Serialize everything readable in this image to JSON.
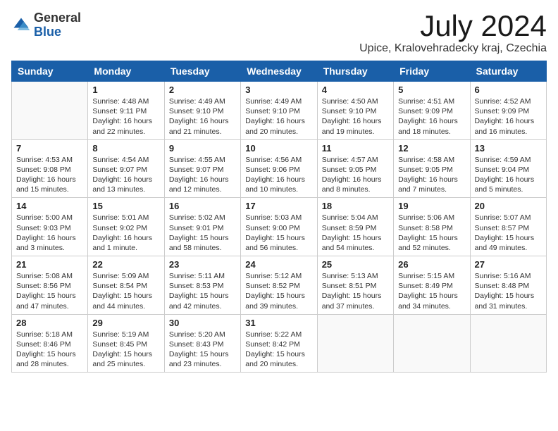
{
  "logo": {
    "general": "General",
    "blue": "Blue"
  },
  "title": "July 2024",
  "location": "Upice, Kralovehradecky kraj, Czechia",
  "days": [
    "Sunday",
    "Monday",
    "Tuesday",
    "Wednesday",
    "Thursday",
    "Friday",
    "Saturday"
  ],
  "weeks": [
    [
      {
        "day": null,
        "content": null
      },
      {
        "day": "1",
        "content": "Sunrise: 4:48 AM\nSunset: 9:11 PM\nDaylight: 16 hours\nand 22 minutes."
      },
      {
        "day": "2",
        "content": "Sunrise: 4:49 AM\nSunset: 9:10 PM\nDaylight: 16 hours\nand 21 minutes."
      },
      {
        "day": "3",
        "content": "Sunrise: 4:49 AM\nSunset: 9:10 PM\nDaylight: 16 hours\nand 20 minutes."
      },
      {
        "day": "4",
        "content": "Sunrise: 4:50 AM\nSunset: 9:10 PM\nDaylight: 16 hours\nand 19 minutes."
      },
      {
        "day": "5",
        "content": "Sunrise: 4:51 AM\nSunset: 9:09 PM\nDaylight: 16 hours\nand 18 minutes."
      },
      {
        "day": "6",
        "content": "Sunrise: 4:52 AM\nSunset: 9:09 PM\nDaylight: 16 hours\nand 16 minutes."
      }
    ],
    [
      {
        "day": "7",
        "content": "Sunrise: 4:53 AM\nSunset: 9:08 PM\nDaylight: 16 hours\nand 15 minutes."
      },
      {
        "day": "8",
        "content": "Sunrise: 4:54 AM\nSunset: 9:07 PM\nDaylight: 16 hours\nand 13 minutes."
      },
      {
        "day": "9",
        "content": "Sunrise: 4:55 AM\nSunset: 9:07 PM\nDaylight: 16 hours\nand 12 minutes."
      },
      {
        "day": "10",
        "content": "Sunrise: 4:56 AM\nSunset: 9:06 PM\nDaylight: 16 hours\nand 10 minutes."
      },
      {
        "day": "11",
        "content": "Sunrise: 4:57 AM\nSunset: 9:05 PM\nDaylight: 16 hours\nand 8 minutes."
      },
      {
        "day": "12",
        "content": "Sunrise: 4:58 AM\nSunset: 9:05 PM\nDaylight: 16 hours\nand 7 minutes."
      },
      {
        "day": "13",
        "content": "Sunrise: 4:59 AM\nSunset: 9:04 PM\nDaylight: 16 hours\nand 5 minutes."
      }
    ],
    [
      {
        "day": "14",
        "content": "Sunrise: 5:00 AM\nSunset: 9:03 PM\nDaylight: 16 hours\nand 3 minutes."
      },
      {
        "day": "15",
        "content": "Sunrise: 5:01 AM\nSunset: 9:02 PM\nDaylight: 16 hours\nand 1 minute."
      },
      {
        "day": "16",
        "content": "Sunrise: 5:02 AM\nSunset: 9:01 PM\nDaylight: 15 hours\nand 58 minutes."
      },
      {
        "day": "17",
        "content": "Sunrise: 5:03 AM\nSunset: 9:00 PM\nDaylight: 15 hours\nand 56 minutes."
      },
      {
        "day": "18",
        "content": "Sunrise: 5:04 AM\nSunset: 8:59 PM\nDaylight: 15 hours\nand 54 minutes."
      },
      {
        "day": "19",
        "content": "Sunrise: 5:06 AM\nSunset: 8:58 PM\nDaylight: 15 hours\nand 52 minutes."
      },
      {
        "day": "20",
        "content": "Sunrise: 5:07 AM\nSunset: 8:57 PM\nDaylight: 15 hours\nand 49 minutes."
      }
    ],
    [
      {
        "day": "21",
        "content": "Sunrise: 5:08 AM\nSunset: 8:56 PM\nDaylight: 15 hours\nand 47 minutes."
      },
      {
        "day": "22",
        "content": "Sunrise: 5:09 AM\nSunset: 8:54 PM\nDaylight: 15 hours\nand 44 minutes."
      },
      {
        "day": "23",
        "content": "Sunrise: 5:11 AM\nSunset: 8:53 PM\nDaylight: 15 hours\nand 42 minutes."
      },
      {
        "day": "24",
        "content": "Sunrise: 5:12 AM\nSunset: 8:52 PM\nDaylight: 15 hours\nand 39 minutes."
      },
      {
        "day": "25",
        "content": "Sunrise: 5:13 AM\nSunset: 8:51 PM\nDaylight: 15 hours\nand 37 minutes."
      },
      {
        "day": "26",
        "content": "Sunrise: 5:15 AM\nSunset: 8:49 PM\nDaylight: 15 hours\nand 34 minutes."
      },
      {
        "day": "27",
        "content": "Sunrise: 5:16 AM\nSunset: 8:48 PM\nDaylight: 15 hours\nand 31 minutes."
      }
    ],
    [
      {
        "day": "28",
        "content": "Sunrise: 5:18 AM\nSunset: 8:46 PM\nDaylight: 15 hours\nand 28 minutes."
      },
      {
        "day": "29",
        "content": "Sunrise: 5:19 AM\nSunset: 8:45 PM\nDaylight: 15 hours\nand 25 minutes."
      },
      {
        "day": "30",
        "content": "Sunrise: 5:20 AM\nSunset: 8:43 PM\nDaylight: 15 hours\nand 23 minutes."
      },
      {
        "day": "31",
        "content": "Sunrise: 5:22 AM\nSunset: 8:42 PM\nDaylight: 15 hours\nand 20 minutes."
      },
      {
        "day": null,
        "content": null
      },
      {
        "day": null,
        "content": null
      },
      {
        "day": null,
        "content": null
      }
    ]
  ]
}
